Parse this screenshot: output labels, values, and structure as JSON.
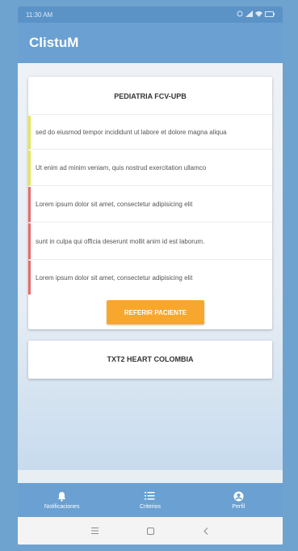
{
  "status_bar": {
    "time": "11:30 AM"
  },
  "app_bar": {
    "title": "ClistuM"
  },
  "card_1": {
    "title": "PEDIATRIA FCV-UPB",
    "items": [
      {
        "text": "sed do eiusmod tempor incididunt ut labore et dolore magna aliqua",
        "accent": "yellow"
      },
      {
        "text": "Ut enim ad minim veniam, quis nostrud exercitation ullamco",
        "accent": "yellow"
      },
      {
        "text": "Lorem ipsum dolor sit amet, consectetur adipisicing elit",
        "accent": "red"
      },
      {
        "text": "sunt in culpa qui officia deserunt mollit anim id est laborum.",
        "accent": "red"
      },
      {
        "text": "Lorem ipsum dolor sit amet, consectetur adipisicing elit",
        "accent": "red"
      }
    ],
    "button_label": "REFERIR PACIENTE"
  },
  "card_2": {
    "title": "TXT2 HEART COLOMBIA"
  },
  "bottom_nav": {
    "items": [
      {
        "label": "Notificaciones",
        "icon": "bell-icon"
      },
      {
        "label": "Criterios",
        "icon": "list-icon"
      },
      {
        "label": "Perfil",
        "icon": "account-circle-icon"
      }
    ]
  },
  "colors": {
    "primary": "#6aa0d2",
    "accent_button": "#f7a72e",
    "accent_yellow": "#e2e85a",
    "accent_red": "#e86a6a"
  }
}
